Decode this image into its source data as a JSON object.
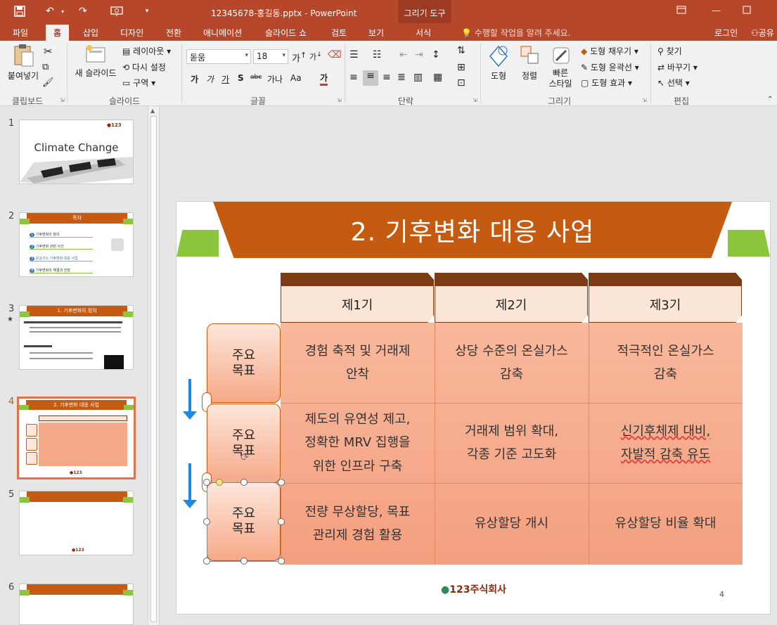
{
  "window": {
    "doc_title": "12345678-홍길동.pptx - PowerPoint",
    "contextual_tab": "그리기 도구"
  },
  "tabs": [
    "파일",
    "홈",
    "삽입",
    "디자인",
    "전환",
    "애니메이션",
    "슬라이드 쇼",
    "검토",
    "보기",
    "서식"
  ],
  "tell_me": "수행할 작업을 알려 주세요.",
  "login": "로그인",
  "share": "공유",
  "ribbon": {
    "clipboard": {
      "paste": "붙여넣기",
      "label": "클립보드"
    },
    "slides": {
      "new_slide": "새 슬라이드",
      "layout": "레이아웃",
      "reset": "다시 설정",
      "section": "구역",
      "label": "슬라이드"
    },
    "font": {
      "name": "돋움",
      "size": "18",
      "label": "글꼴",
      "b": "가",
      "i": "가",
      "u": "가",
      "s": "S",
      "strike": "abc",
      "spacing": "가나",
      "case": "Aa",
      "color": "가"
    },
    "paragraph": {
      "label": "단락"
    },
    "drawing": {
      "shape": "도형",
      "arrange": "정렬",
      "quick_style": "빠른\n스타일",
      "fill": "도형 채우기",
      "outline": "도형 윤곽선",
      "effect": "도형 효과",
      "label": "그리기"
    },
    "editing": {
      "find": "찾기",
      "replace": "바꾸기",
      "select": "선택",
      "label": "편집"
    }
  },
  "thumbnails": [
    {
      "num": "1",
      "title": "Climate Change"
    },
    {
      "num": "2",
      "title": "목차",
      "items": [
        "기후변화의 정의",
        "기후변화 관련 사건",
        "온실가스 기후변화 대응 사업",
        "기후변화의 해결과 전망"
      ]
    },
    {
      "num": "3",
      "title": "1. 기후변화의 정의"
    },
    {
      "num": "4",
      "title": "2. 기후변화 대응 사업"
    },
    {
      "num": "5",
      "title": ""
    },
    {
      "num": "6",
      "title": ""
    }
  ],
  "slide": {
    "title": "2. 기후변화 대응 사업",
    "columns": [
      "제1기",
      "제2기",
      "제3기"
    ],
    "rows": [
      {
        "header": "주요\n목표",
        "cells": [
          "경험 축적 및 거래제\n안착",
          "상당 수준의 온실가스\n감축",
          "적극적인 온실가스\n감축"
        ]
      },
      {
        "header": "주요\n목표",
        "cells": [
          "제도의 유연성 제고,\n정확한 MRV 집행을\n위한 인프라 구축",
          "거래제 범위 확대,\n각종 기준 고도화",
          "신기후체제 대비,\n자발적 감축 유도"
        ]
      },
      {
        "header": "주요\n목표",
        "cells": [
          "전량 무상할당, 목표\n관리제 경험 활용",
          "유상할당 개시",
          "유상할당 비율 확대"
        ]
      }
    ],
    "logo": "123주식회사",
    "page_number": "4"
  },
  "colors": {
    "accent": "#b7472a",
    "banner": "#c55a11",
    "green": "#8cc63f",
    "cell": "#f4a080"
  }
}
